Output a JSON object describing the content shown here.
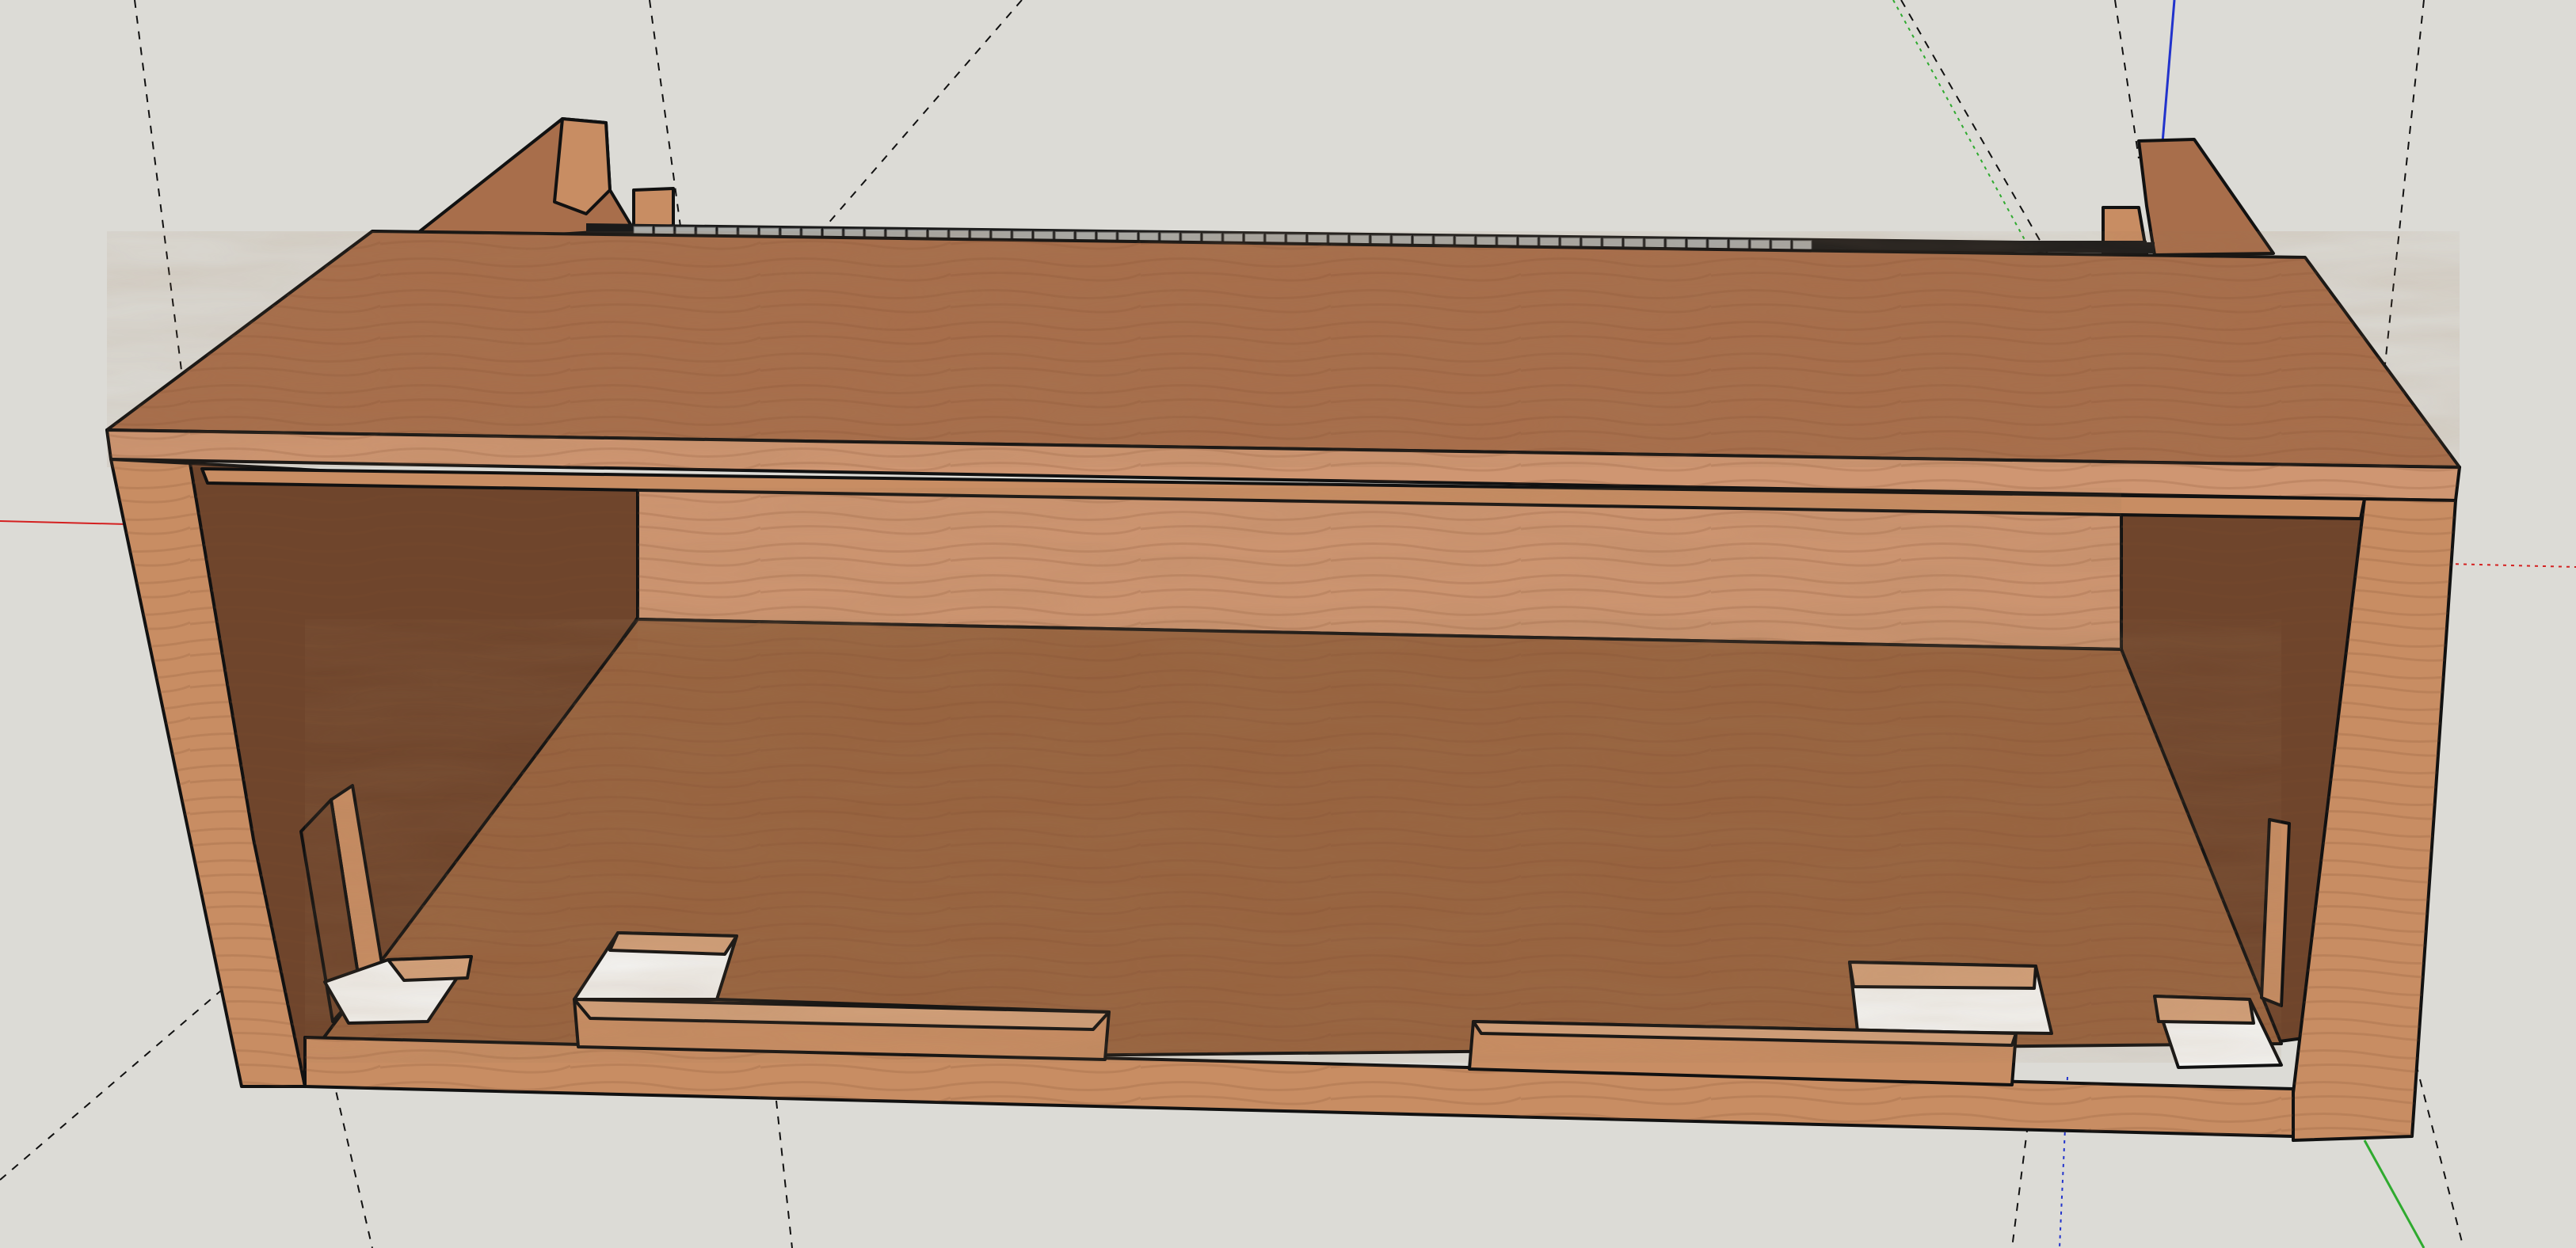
{
  "viewport": {
    "background": "#dcdbd6",
    "grain_stroke": "#7a4a2c"
  },
  "colors": {
    "wood_top": "#a86e4b",
    "wood_side_light": "#c88d63",
    "wood_inside_dark": "#6f452c",
    "wood_back": "#cf9672",
    "wood_floor": "#98633f",
    "wood_edge": "#d2a07a",
    "key_light": "#a9aaa7",
    "key_dark": "#1a1a1a",
    "axis_red": "#d42020",
    "axis_green": "#2faa2f",
    "axis_blue": "#2233cc",
    "outline": "#111111",
    "guide": "#111111"
  },
  "axes": [
    "red-axis",
    "green-axis",
    "blue-axis"
  ],
  "model": {
    "object": "wooden cabinet",
    "keys_count": 56
  }
}
